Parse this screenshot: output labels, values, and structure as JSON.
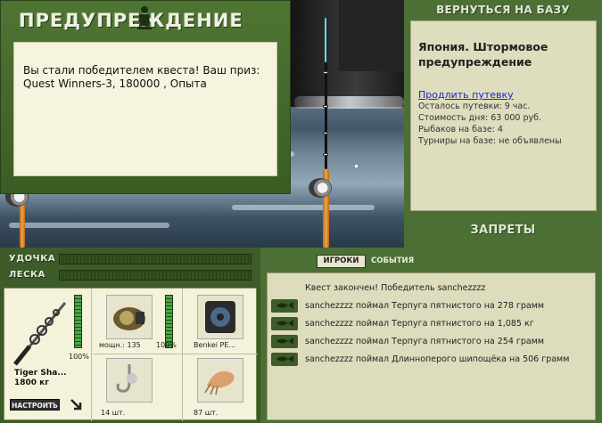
{
  "modal": {
    "title": "ПРЕДУПРЕЖДЕНИЕ",
    "message": "Вы стали победителем квеста! Ваш приз: Quest Winners-3, 180000 , Опыта"
  },
  "base": {
    "return_button": "ВЕРНУТЬСЯ НА БАЗУ",
    "title": "Япония. Штормовое предупреждение",
    "extend_link": "Продлить путевку",
    "remaining": "Осталось путевки: 9 час.",
    "day_cost": "Стоимость дня: 63 000 руб.",
    "fishers": "Рыбаков на базе: 4",
    "tournaments": "Турниры на базе: не объявлены",
    "bans_button": "ЗАПРЕТЫ"
  },
  "gauges": {
    "rod_label": "УДОЧКА",
    "line_label": "ЛЕСКА"
  },
  "inventory": {
    "rod_name": "Tiger Sha...",
    "rod_capacity": "1800 кг",
    "rod_level": "100%",
    "reel_power": "мощн.: 135",
    "reel_level": "100%",
    "line_name": "Benkei PE...",
    "lure_count": "14 шт.",
    "bait_count": "87 шт.",
    "setup_button": "НАСТРОИТЬ"
  },
  "events": {
    "tab_players": "ИГРОКИ",
    "tab_events": "СОБЫТИЯ",
    "items": [
      "Квест закончен! Победитель sanchezzzz",
      "sanchezzzz поймал Терпуга пятнистого на 278 грамм",
      "sanchezzzz поймал Терпуга пятнистого на 1,085 кг",
      "sanchezzzz поймал Терпуга пятнистого на 254 грамм",
      "sanchezzzz поймал Длинноперого шипощёка на 506 грамм"
    ]
  }
}
